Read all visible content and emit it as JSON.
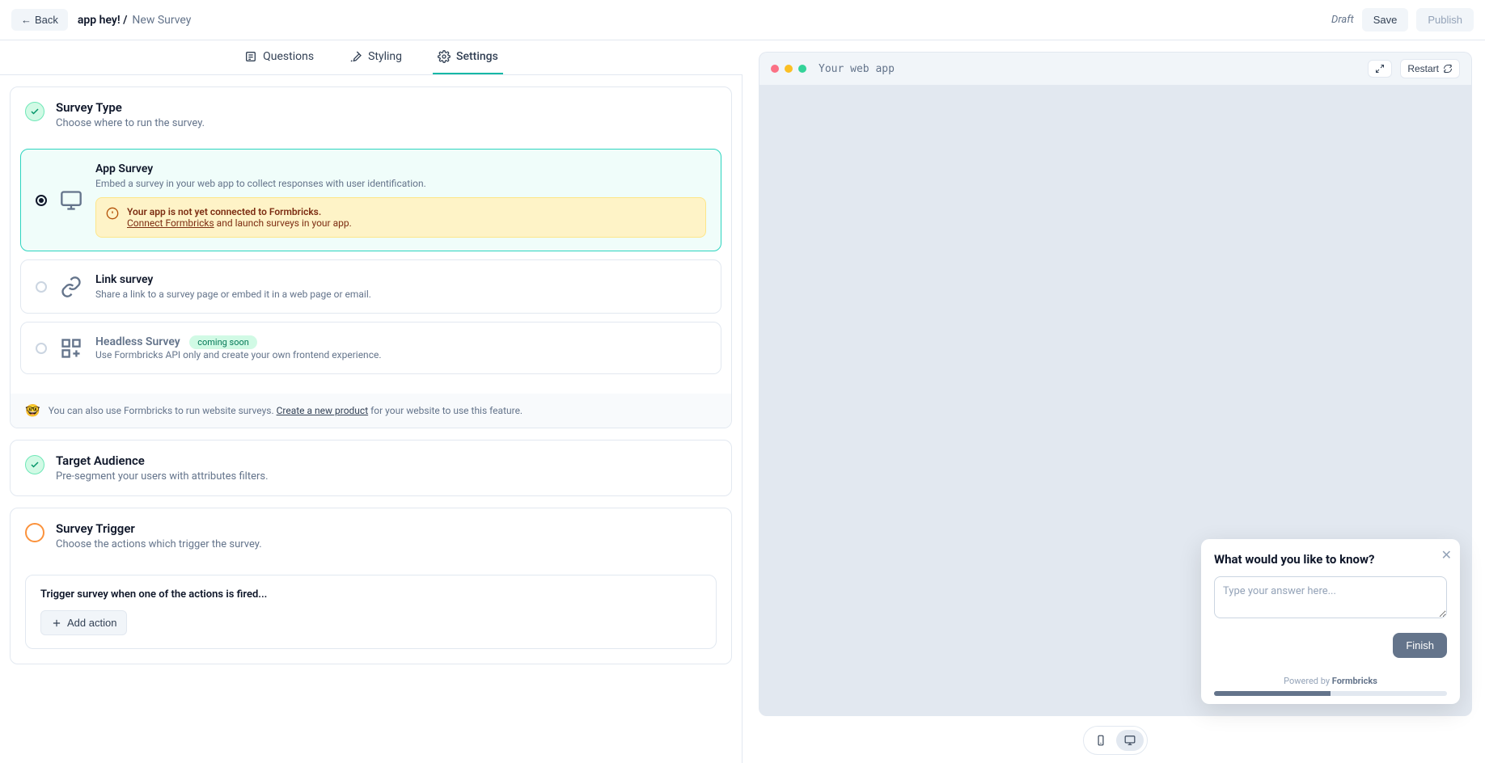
{
  "header": {
    "back": "Back",
    "app_name": "app hey! /",
    "page_name": "New Survey",
    "status": "Draft",
    "save": "Save",
    "publish": "Publish"
  },
  "tabs": {
    "questions": "Questions",
    "styling": "Styling",
    "settings": "Settings"
  },
  "survey_type": {
    "title": "Survey Type",
    "subtitle": "Choose where to run the survey.",
    "app_survey": {
      "title": "App Survey",
      "desc": "Embed a survey in your web app to collect responses with user identification.",
      "warning_title": "Your app is not yet connected to Formbricks.",
      "warning_link": "Connect Formbricks",
      "warning_rest": " and launch surveys in your app."
    },
    "link_survey": {
      "title": "Link survey",
      "desc": "Share a link to a survey page or embed it in a web page or email."
    },
    "headless": {
      "title": "Headless Survey",
      "badge": "coming soon",
      "desc": "Use Formbricks API only and create your own frontend experience."
    },
    "info_pre": "You can also use Formbricks to run website surveys. ",
    "info_link": "Create a new product",
    "info_post": " for your website to use this feature."
  },
  "target": {
    "title": "Target Audience",
    "subtitle": "Pre-segment your users with attributes filters."
  },
  "trigger": {
    "title": "Survey Trigger",
    "subtitle": "Choose the actions which trigger the survey.",
    "when_text": "Trigger survey when one of the actions is fired...",
    "add_action": "Add action"
  },
  "preview": {
    "chrome_title": "Your web app",
    "restart": "Restart",
    "popup_title": "What would you like to know?",
    "placeholder": "Type your answer here...",
    "finish": "Finish",
    "powered_pre": "Powered by ",
    "powered_brand": "Formbricks"
  }
}
